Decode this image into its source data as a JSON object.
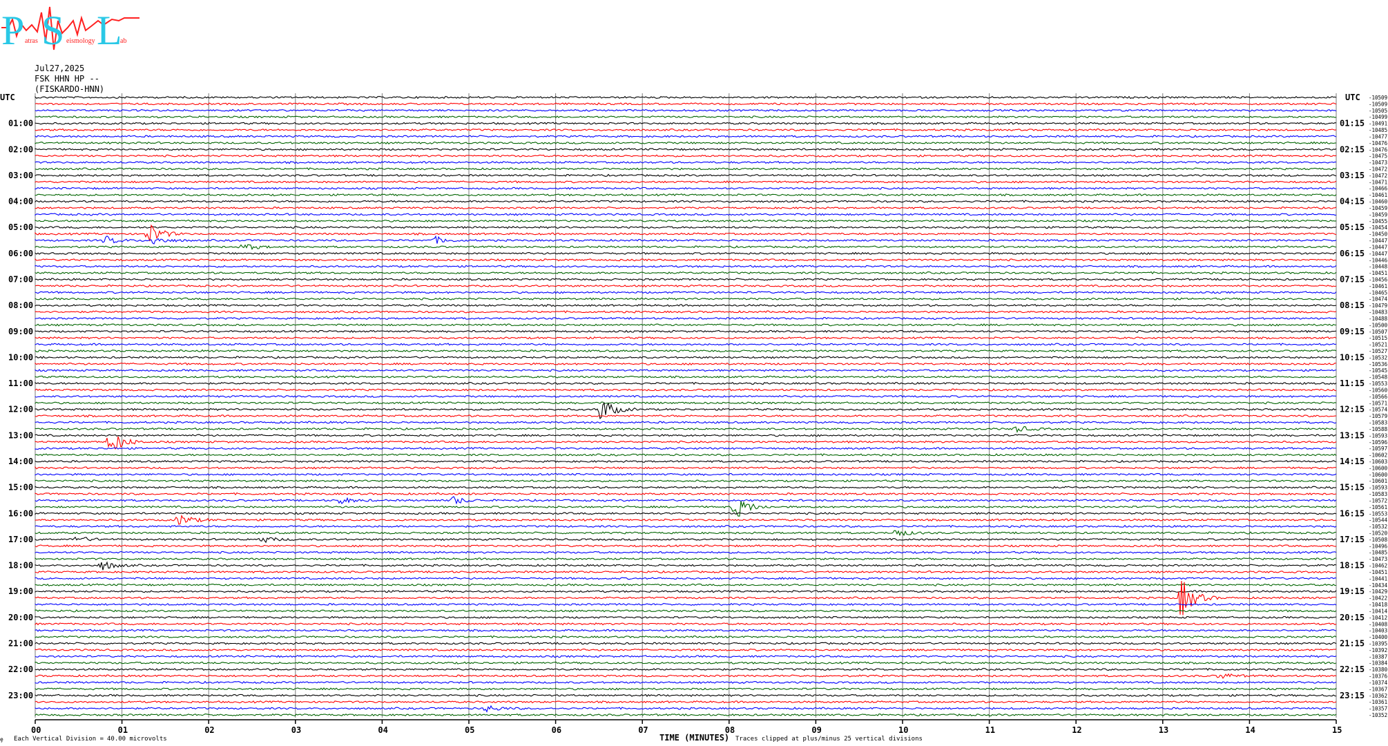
{
  "logo": {
    "letters": [
      "P",
      "S",
      "L"
    ],
    "words": [
      "atras",
      "eismology",
      "ab"
    ],
    "colors": {
      "letters": "#2ac8e6",
      "trace": "#ff2020"
    }
  },
  "header": {
    "date": "Jul27,2025",
    "station": "FSK HHN HP --",
    "site": "(FISKARDO-HNN)"
  },
  "chart_data": {
    "type": "line",
    "title": "",
    "xlabel": "TIME (MINUTES)",
    "xlim": [
      0,
      15
    ],
    "x_ticks": [
      "00",
      "01",
      "02",
      "03",
      "04",
      "05",
      "06",
      "07",
      "08",
      "09",
      "10",
      "11",
      "12",
      "13",
      "14",
      "15"
    ],
    "left_axis_label": "UTC",
    "right_axis_label": "UTC",
    "left_hour_labels": [
      "01:00",
      "02:00",
      "03:00",
      "04:00",
      "05:00",
      "06:00",
      "07:00",
      "08:00",
      "09:00",
      "10:00",
      "11:00",
      "12:00",
      "13:00",
      "14:00",
      "15:00",
      "16:00",
      "17:00",
      "18:00",
      "19:00",
      "20:00",
      "21:00",
      "22:00",
      "23:00"
    ],
    "right_hour_labels": [
      "01:15",
      "02:15",
      "03:15",
      "04:15",
      "05:15",
      "06:15",
      "07:15",
      "08:15",
      "09:15",
      "10:15",
      "11:15",
      "12:15",
      "13:15",
      "14:15",
      "15:15",
      "16:15",
      "17:15",
      "18:15",
      "19:15",
      "20:15",
      "21:15",
      "22:15",
      "23:15"
    ],
    "trace_minutes": 15,
    "trace_count": 96,
    "trace_colors": [
      "#000000",
      "#ff0000",
      "#0000ff",
      "#006400"
    ],
    "trace_offset_values": [
      -10509,
      -10509,
      -10505,
      -10499,
      -10491,
      -10485,
      -10477,
      -10476,
      -10476,
      -10475,
      -10473,
      -10472,
      -10472,
      -10471,
      -10466,
      -10461,
      -10460,
      -10459,
      -10459,
      -10455,
      -10454,
      -10450,
      -10447,
      -10447,
      -10447,
      -10446,
      -10448,
      -10451,
      -10456,
      -10461,
      -10465,
      -10474,
      -10479,
      -10483,
      -10488,
      -10500,
      -10507,
      -10515,
      -10521,
      -10527,
      -10532,
      -10536,
      -10545,
      -10548,
      -10553,
      -10560,
      -10566,
      -10571,
      -10574,
      -10579,
      -10583,
      -10588,
      -10593,
      -10596,
      -10597,
      -10602,
      -10603,
      -10600,
      -10600,
      -10601,
      -10593,
      -10583,
      -10572,
      -10561,
      -10553,
      -10544,
      -10532,
      -10520,
      -10508,
      -10496,
      -10485,
      -10473,
      -10462,
      -10451,
      -10441,
      -10434,
      -10429,
      -10422,
      -10418,
      -10414,
      -10412,
      -10408,
      -10403,
      -10400,
      -10395,
      -10392,
      -10387,
      -10384,
      -10380,
      -10376,
      -10374,
      -10367,
      -10362,
      -10361,
      -10357,
      -10352
    ],
    "events": [
      {
        "trace": 22,
        "minute": 0.8,
        "amplitude": 0.5
      },
      {
        "trace": 21,
        "minute": 1.3,
        "amplitude": 1.3
      },
      {
        "trace": 22,
        "minute": 1.35,
        "amplitude": 0.5
      },
      {
        "trace": 23,
        "minute": 2.4,
        "amplitude": 0.4
      },
      {
        "trace": 22,
        "minute": 4.6,
        "amplitude": 0.4
      },
      {
        "trace": 48,
        "minute": 6.5,
        "amplitude": 1.6
      },
      {
        "trace": 53,
        "minute": 0.85,
        "amplitude": 1.6
      },
      {
        "trace": 51,
        "minute": 11.3,
        "amplitude": 0.4
      },
      {
        "trace": 62,
        "minute": 3.5,
        "amplitude": 0.4
      },
      {
        "trace": 62,
        "minute": 4.8,
        "amplitude": 0.5
      },
      {
        "trace": 63,
        "minute": 8.05,
        "amplitude": 1.6
      },
      {
        "trace": 65,
        "minute": 1.65,
        "amplitude": 0.7
      },
      {
        "trace": 68,
        "minute": 0.45,
        "amplitude": 0.4
      },
      {
        "trace": 68,
        "minute": 2.6,
        "amplitude": 0.4
      },
      {
        "trace": 67,
        "minute": 9.9,
        "amplitude": 0.5
      },
      {
        "trace": 72,
        "minute": 0.75,
        "amplitude": 0.6
      },
      {
        "trace": 77,
        "minute": 13.2,
        "amplitude": 2.5
      },
      {
        "trace": 89,
        "minute": 13.65,
        "amplitude": 0.4
      },
      {
        "trace": 94,
        "minute": 5.2,
        "amplitude": 0.4
      }
    ],
    "footer": {
      "scale_prefix": "Each Vertical Division =",
      "scale_value": "40.00 microvolts",
      "clip_note": "Traces clipped at plus/minus 25 vertical divisions",
      "mark": "̧e"
    }
  }
}
